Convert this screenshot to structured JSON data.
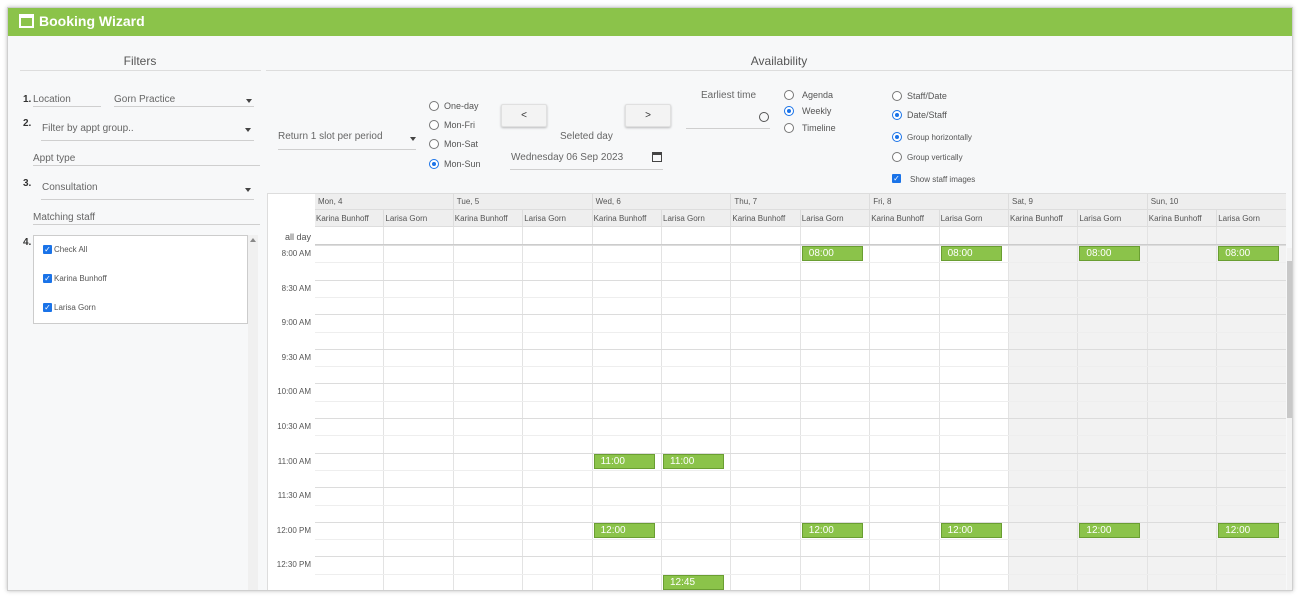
{
  "window": {
    "title": "Booking Wizard"
  },
  "filters": {
    "heading": "Filters",
    "location": {
      "step": "1.",
      "label": "Location",
      "value": "Gorn Practice"
    },
    "appt_group": {
      "step": "2.",
      "placeholder": "Filter by appt group.."
    },
    "appt_type": {
      "label": "Appt type"
    },
    "type_select": {
      "step": "3.",
      "value": "Consultation"
    },
    "matching_staff": {
      "label": "Matching staff"
    },
    "staff_list": {
      "step": "4.",
      "items": [
        {
          "label": "Check All",
          "checked": true
        },
        {
          "label": "Karina Bunhoff",
          "checked": true
        },
        {
          "label": "Larisa Gorn",
          "checked": true
        }
      ]
    }
  },
  "availability": {
    "heading": "Availability",
    "slot_select": "Return 1 slot per period",
    "day_range": {
      "options": [
        "One-day",
        "Mon-Fri",
        "Mon-Sat",
        "Mon-Sun"
      ],
      "selected": "Mon-Sun"
    },
    "prev_label": "<",
    "next_label": ">",
    "selected_day": {
      "label": "Seleted day",
      "value": "Wednesday 06 Sep 2023"
    },
    "earliest_time": {
      "label": "Earliest time",
      "value": ""
    },
    "view": {
      "options": [
        "Agenda",
        "Weekly",
        "Timeline"
      ],
      "selected": "Weekly"
    },
    "grouping": {
      "options": [
        "Staff/Date",
        "Date/Staff"
      ],
      "selected": "Date/Staff"
    },
    "orientation": {
      "options": [
        "Group horizontally",
        "Group vertically"
      ],
      "selected": "Group horizontally"
    },
    "show_staff_images": {
      "label": "Show staff images",
      "checked": true
    }
  },
  "calendar": {
    "days": [
      {
        "label": "Mon, 4",
        "weekend": false
      },
      {
        "label": "Tue, 5",
        "weekend": false
      },
      {
        "label": "Wed, 6",
        "weekend": false
      },
      {
        "label": "Thu, 7",
        "weekend": false
      },
      {
        "label": "Fri, 8",
        "weekend": false
      },
      {
        "label": "Sat, 9",
        "weekend": true
      },
      {
        "label": "Sun, 10",
        "weekend": true
      }
    ],
    "staff": [
      "Karina Bunhoff",
      "Larisa Gorn"
    ],
    "all_day_label": "all day",
    "times": [
      "8:00 AM",
      "8:30 AM",
      "9:00 AM",
      "9:30 AM",
      "10:00 AM",
      "10:30 AM",
      "11:00 AM",
      "11:30 AM",
      "12:00 PM",
      "12:30 PM"
    ],
    "slots": [
      {
        "day": 3,
        "staff": 1,
        "time": "08:00"
      },
      {
        "day": 4,
        "staff": 1,
        "time": "08:00"
      },
      {
        "day": 5,
        "staff": 1,
        "time": "08:00"
      },
      {
        "day": 6,
        "staff": 1,
        "time": "08:00"
      },
      {
        "day": 2,
        "staff": 0,
        "time": "11:00"
      },
      {
        "day": 2,
        "staff": 1,
        "time": "11:00"
      },
      {
        "day": 2,
        "staff": 0,
        "time": "12:00"
      },
      {
        "day": 3,
        "staff": 1,
        "time": "12:00"
      },
      {
        "day": 4,
        "staff": 1,
        "time": "12:00"
      },
      {
        "day": 5,
        "staff": 1,
        "time": "12:00"
      },
      {
        "day": 6,
        "staff": 1,
        "time": "12:00"
      },
      {
        "day": 2,
        "staff": 1,
        "time": "12:45"
      }
    ]
  }
}
